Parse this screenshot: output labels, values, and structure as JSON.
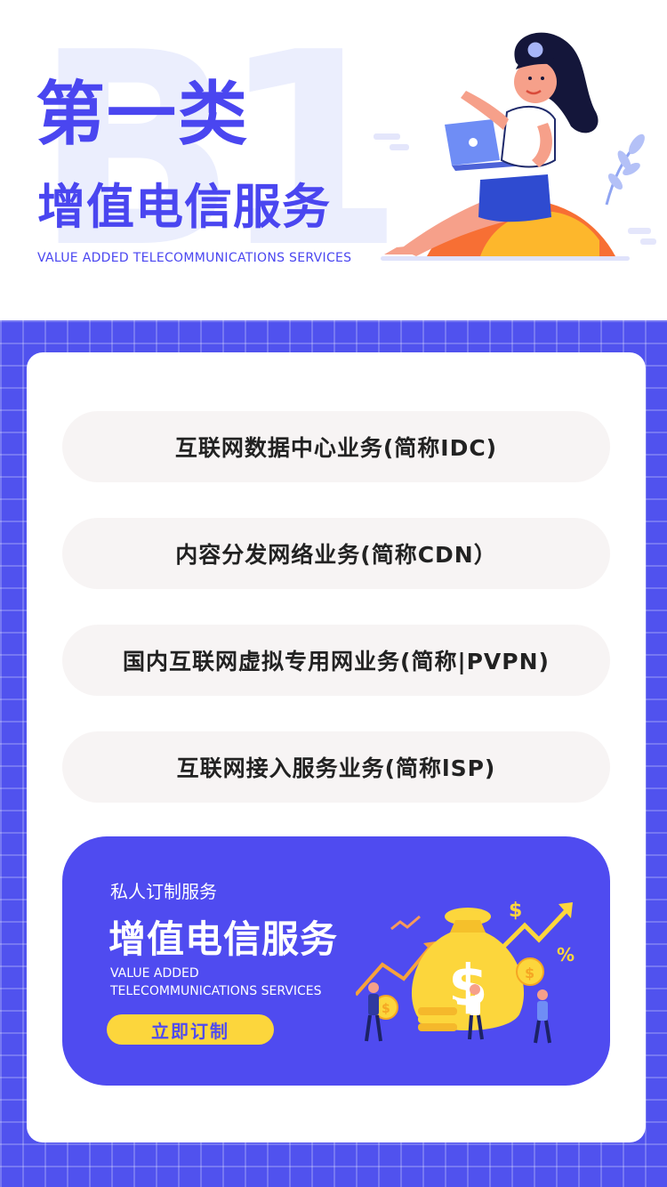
{
  "header": {
    "title_line1": "第一类",
    "title_line2": "增值电信服务",
    "subtitle_en": "VALUE ADDED TELECOMMUNICATIONS SERVICES"
  },
  "services": [
    {
      "label": "互联网数据中心业务(简称IDC)"
    },
    {
      "label": "内容分发网络业务(简称CDN）"
    },
    {
      "label": "国内互联网虚拟专用网业务(简称|PVPN)"
    },
    {
      "label": "互联网接入服务业务(简称lSP)"
    }
  ],
  "banner": {
    "label": "私人订制服务",
    "title": "增值电信服务",
    "subtitle_line1": "VALUE ADDED",
    "subtitle_line2": "TELECOMMUNICATIONS SERVICES",
    "button": "立即订制"
  },
  "colors": {
    "primary": "#4a46f0",
    "accent_yellow": "#fcd63c",
    "pill_bg": "#f7f4f4"
  }
}
